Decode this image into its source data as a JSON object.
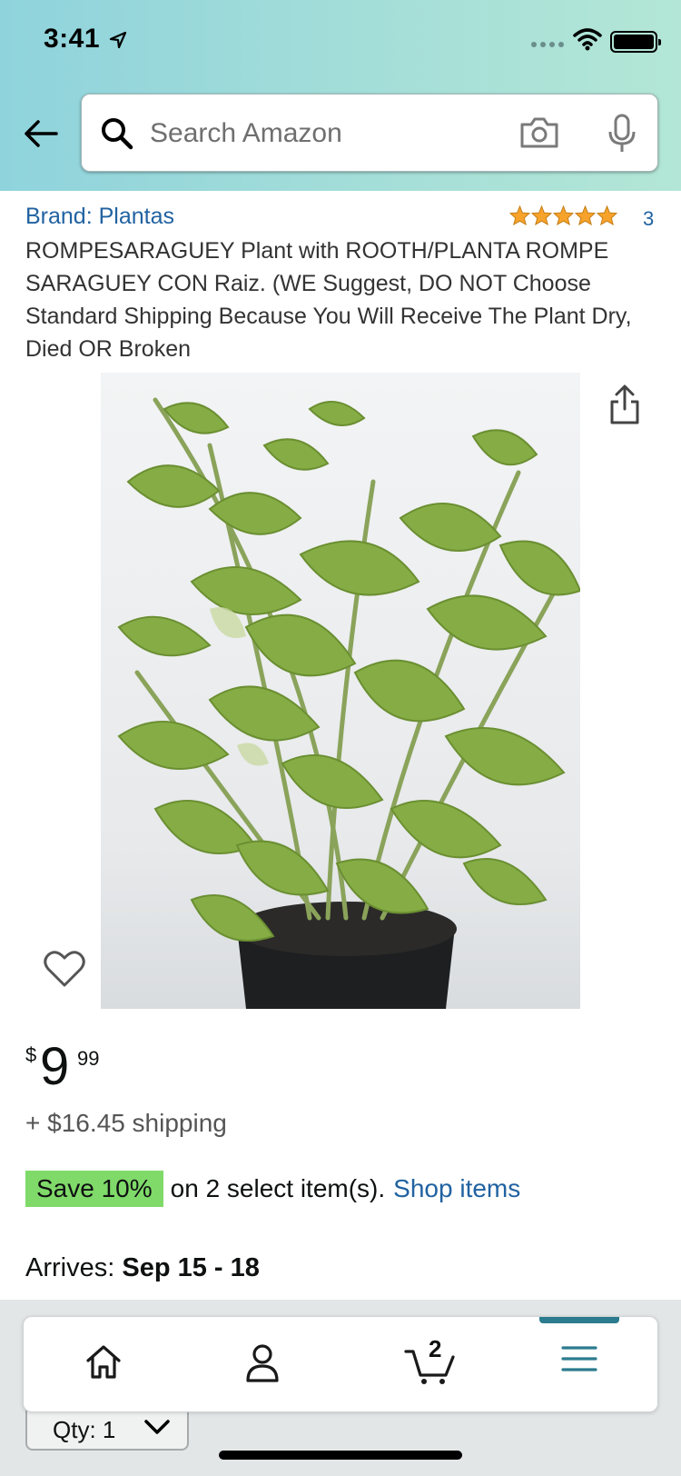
{
  "status_bar": {
    "time": "3:41"
  },
  "search": {
    "placeholder": "Search Amazon"
  },
  "product": {
    "brand": "Brand: Plantas",
    "rating_stars": 5,
    "rating_count": "3",
    "title": "ROMPESARAGUEY Plant with ROOTH/PLANTA ROMPE SARAGUEY CON Raiz. (WE Suggest, DO NOT Choose Standard Shipping Because You Will Receive The Plant Dry, Died OR Broken",
    "price": {
      "symbol": "$",
      "whole": "9",
      "fraction": "99"
    },
    "shipping": "+ $16.45 shipping",
    "promo": {
      "badge": "Save 10%",
      "text": "on 2 select item(s).",
      "link": "Shop items"
    },
    "arrives": {
      "label": "Arrives:",
      "date": "Sep 15 - 18"
    },
    "quantity": {
      "label": "Qty:",
      "value": "1"
    }
  },
  "tabbar": {
    "items": [
      {
        "name": "home",
        "icon": "home-icon"
      },
      {
        "name": "account",
        "icon": "person-icon"
      },
      {
        "name": "cart",
        "icon": "cart-icon",
        "badge": "2"
      },
      {
        "name": "menu",
        "icon": "menu-icon",
        "active": true
      }
    ]
  },
  "colors": {
    "header_gradient_start": "#8fd3dc",
    "header_gradient_end": "#b3e6d6",
    "link": "#2162a1",
    "promo_badge": "#7fda69",
    "star": "#f7a32b",
    "tab_active": "#2c7b8e"
  }
}
